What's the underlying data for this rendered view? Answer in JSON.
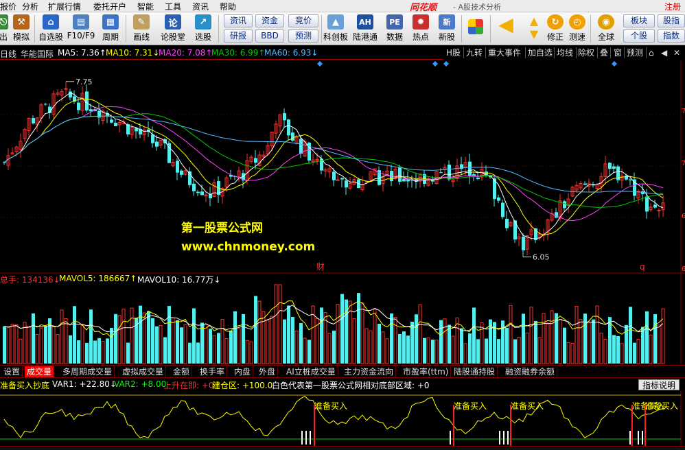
{
  "menu": {
    "items": [
      "报价",
      "分析",
      "扩展行情",
      "委托开户",
      "智能",
      "工具",
      "资讯",
      "帮助"
    ],
    "brand": "同花顺",
    "subtitle": "- A股技术分析",
    "login": "注册"
  },
  "toolbar": {
    "buttons": [
      {
        "label": "出",
        "icon": "exit-icon"
      },
      {
        "label": "模拟",
        "icon": "hammer-icon"
      },
      {
        "label": "自选股",
        "icon": "home-icon"
      },
      {
        "label": "F10/F9",
        "icon": "f10-icon"
      },
      {
        "label": "周期",
        "icon": "calendar-icon"
      },
      {
        "label": "画线",
        "icon": "pencil-icon"
      },
      {
        "label": "论股堂",
        "icon": "forum-icon"
      },
      {
        "label": "选股",
        "icon": "stock-picker-icon"
      },
      {
        "label": "科创板",
        "icon": "star-market-icon"
      },
      {
        "label": "陆港通",
        "icon": "ah-icon"
      },
      {
        "label": "数据",
        "icon": "pe-icon"
      },
      {
        "label": "热点",
        "icon": "hot-icon"
      },
      {
        "label": "新股",
        "icon": "ipo-icon"
      },
      {
        "label": "修正",
        "icon": "correct-icon"
      },
      {
        "label": "测速",
        "icon": "speed-test-icon"
      },
      {
        "label": "全球",
        "icon": "globe-icon"
      }
    ],
    "pill_buttons": [
      "资讯",
      "研报",
      "资金",
      "BBD",
      "竞价",
      "预测",
      "板块",
      "个股",
      "股指",
      "指数"
    ],
    "ah_text": "AH",
    "pe_text": "PE",
    "new_text": "新"
  },
  "kline_info": {
    "period": "日线",
    "stock_name": "华能国际",
    "ma5": "MA5: 7.36↑",
    "ma10": "MA10: 7.31↓",
    "ma20": "MA20: 7.08↑",
    "ma30": "MA30: 6.99↑",
    "ma60": "MA60: 6.93↓"
  },
  "right_tools": [
    "H股",
    "九转",
    "重大事件",
    "加自选",
    "均线",
    "除权",
    "叠",
    "窗",
    "预测",
    "⌂",
    "◀",
    "✕"
  ],
  "markers": {
    "high": "7.75",
    "low": "6.05",
    "cai": "财",
    "q": "q"
  },
  "colors": {
    "ma5": "#ffffff",
    "ma10": "#ffff00",
    "ma20": "#ff44ff",
    "ma30": "#00cc00",
    "ma60": "#55bbff",
    "up": "#ff3030",
    "down": "#55eeee",
    "accent": "#ff0000"
  },
  "volume_info": {
    "total": "总手: 134136↓",
    "mavol5": "MAVOL5: 186667↑",
    "mavol10": "MAVOL10: 16.77万↓"
  },
  "tabs": [
    "设置",
    "成交量",
    "多周期成交量",
    "虚拟成交量",
    "金额",
    "换手率",
    "内盘",
    "外盘",
    "AI立桩成交量",
    "主力资金流向",
    "市盈率(ttm)",
    "陆股通持股",
    "融资融券余额"
  ],
  "active_tab": "成交量",
  "indicator_info": {
    "name": "准备买入抄底",
    "var1": "VAR1: +22.80↓",
    "var2": "VAR2: +8.00",
    "rise": "上升在即: +0",
    "build": "建仓区: +100.0",
    "white_text": "白色代表第一股票公式网相对底部区域: +0",
    "help": "指标说明"
  },
  "signal_label": "准备买入",
  "watermark": {
    "name": "第一股票公式网",
    "url": "www.chnmoney.com"
  },
  "axis_digits": [
    "7",
    "7",
    "6",
    "6"
  ]
}
